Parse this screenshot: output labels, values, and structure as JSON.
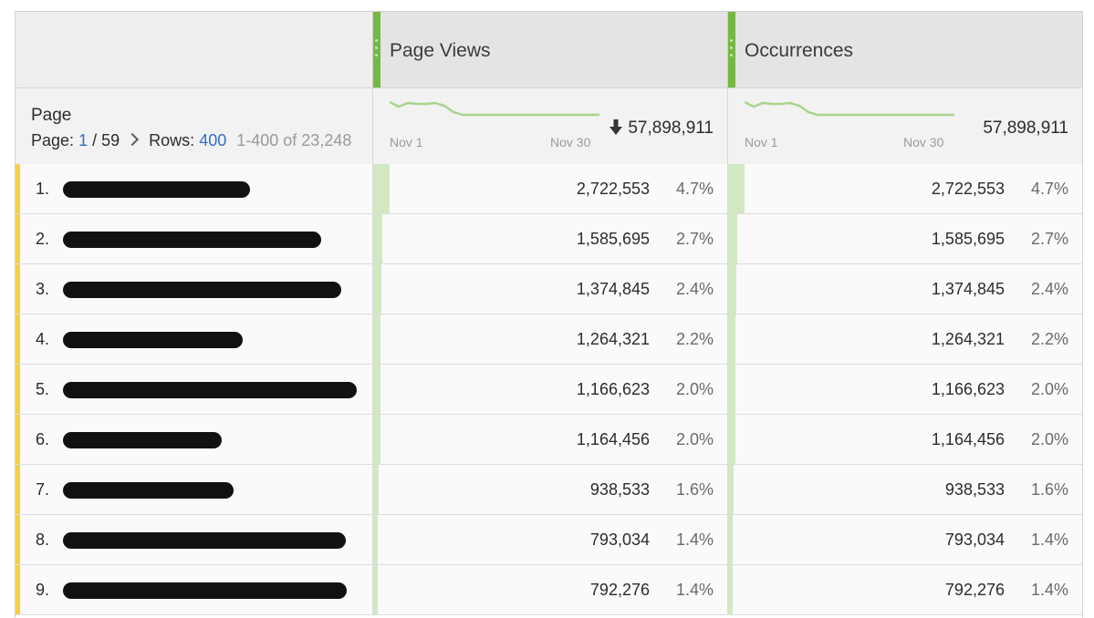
{
  "columns": {
    "page_views": {
      "title": "Page Views",
      "total": "57,898,911",
      "date_start": "Nov 1",
      "date_end": "Nov 30",
      "trend": [
        3,
        8,
        4,
        5,
        5,
        4,
        7,
        14,
        17,
        17,
        17,
        17,
        17,
        17,
        17,
        17,
        17,
        17,
        17,
        17,
        17,
        17,
        17,
        17
      ]
    },
    "occurrences": {
      "title": "Occurrences",
      "total": "57,898,911",
      "date_start": "Nov 1",
      "date_end": "Nov 30",
      "trend": [
        3,
        8,
        4,
        5,
        5,
        4,
        7,
        14,
        17,
        17,
        17,
        17,
        17,
        17,
        17,
        17,
        17,
        17,
        17,
        17,
        17,
        17,
        17,
        17
      ]
    }
  },
  "dimension": {
    "label": "Page",
    "page_prefix": "Page:",
    "page_current": "1",
    "page_total": "/ 59",
    "rows_label": "Rows:",
    "rows_value": "400",
    "range_text": "1-400 of 23,248"
  },
  "rows": [
    {
      "num": "1.",
      "views": "2,722,553",
      "views_pct": "4.7%",
      "occ": "2,722,553",
      "occ_pct": "4.7%",
      "share": 0.047
    },
    {
      "num": "2.",
      "views": "1,585,695",
      "views_pct": "2.7%",
      "occ": "1,585,695",
      "occ_pct": "2.7%",
      "share": 0.027
    },
    {
      "num": "3.",
      "views": "1,374,845",
      "views_pct": "2.4%",
      "occ": "1,374,845",
      "occ_pct": "2.4%",
      "share": 0.024
    },
    {
      "num": "4.",
      "views": "1,264,321",
      "views_pct": "2.2%",
      "occ": "1,264,321",
      "occ_pct": "2.2%",
      "share": 0.022
    },
    {
      "num": "5.",
      "views": "1,166,623",
      "views_pct": "2.0%",
      "occ": "1,166,623",
      "occ_pct": "2.0%",
      "share": 0.02
    },
    {
      "num": "6.",
      "views": "1,164,456",
      "views_pct": "2.0%",
      "occ": "1,164,456",
      "occ_pct": "2.0%",
      "share": 0.02
    },
    {
      "num": "7.",
      "views": "938,533",
      "views_pct": "1.6%",
      "occ": "938,533",
      "occ_pct": "1.6%",
      "share": 0.016
    },
    {
      "num": "8.",
      "views": "793,034",
      "views_pct": "1.4%",
      "occ": "793,034",
      "occ_pct": "1.4%",
      "share": 0.014
    },
    {
      "num": "9.",
      "views": "792,276",
      "views_pct": "1.4%",
      "occ": "792,276",
      "occ_pct": "1.4%",
      "share": 0.014
    }
  ],
  "colors": {
    "accent_green": "#74b843",
    "row_marker": "#f7cf45",
    "link_blue": "#2f6fcc",
    "bar_fill": "#d2e8c3",
    "sparkline": "#a9d48b"
  },
  "icons": {
    "column_handle": "drag-handle-icon",
    "pager_next": "chevron-right-icon",
    "trend_down": "arrow-down-icon"
  }
}
